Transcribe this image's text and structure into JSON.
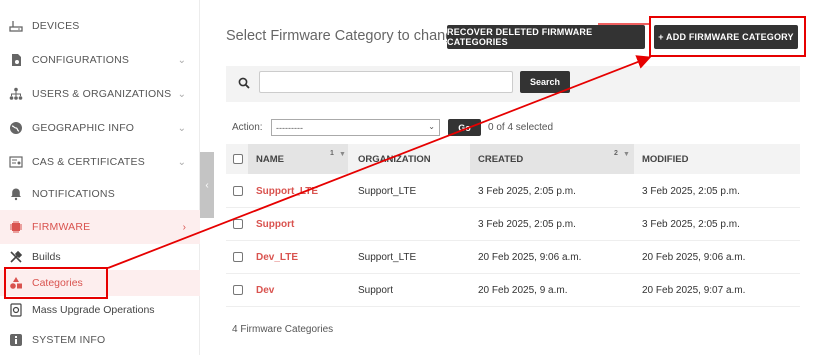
{
  "sidebar": {
    "items": [
      {
        "label": "DEVICES",
        "icon": "router-icon",
        "chevron": ""
      },
      {
        "label": "CONFIGURATIONS",
        "icon": "config-file-icon",
        "chevron": "⌄"
      },
      {
        "label": "USERS & ORGANIZATIONS",
        "icon": "org-tree-icon",
        "chevron": "⌄"
      },
      {
        "label": "GEOGRAPHIC INFO",
        "icon": "globe-icon",
        "chevron": "⌄"
      },
      {
        "label": "CAS & CERTIFICATES",
        "icon": "certificate-icon",
        "chevron": "⌄"
      },
      {
        "label": "NOTIFICATIONS",
        "icon": "bell-icon",
        "chevron": ""
      },
      {
        "label": "FIRMWARE",
        "icon": "chip-icon",
        "chevron": "›"
      }
    ],
    "sub_items": [
      {
        "label": "Builds",
        "icon": "tools-icon"
      },
      {
        "label": "Categories",
        "icon": "shapes-icon"
      },
      {
        "label": "Mass Upgrade Operations",
        "icon": "upgrade-icon"
      }
    ],
    "system_info": "SYSTEM INFO",
    "toggle": "‹"
  },
  "main": {
    "title": "Select Firmware Category to change",
    "recover_button": "RECOVER DELETED FIRMWARE CATEGORIES",
    "add_button": "+ ADD FIRMWARE CATEGORY",
    "search_button": "Search",
    "search_value": "",
    "action_label": "Action:",
    "action_selected": "---------",
    "go_button": "Go",
    "selected_text": "0 of 4 selected",
    "columns": {
      "name": "NAME",
      "name_sort": "1",
      "organization": "ORGANIZATION",
      "created": "CREATED",
      "created_sort": "2",
      "modified": "MODIFIED"
    },
    "rows": [
      {
        "name": "Support_LTE",
        "organization": "Support_LTE",
        "created": "3 Feb 2025, 2:05 p.m.",
        "modified": "3 Feb 2025, 2:05 p.m."
      },
      {
        "name": "Support",
        "organization": "",
        "created": "3 Feb 2025, 2:05 p.m.",
        "modified": "3 Feb 2025, 2:05 p.m."
      },
      {
        "name": "Dev_LTE",
        "organization": "Support_LTE",
        "created": "20 Feb 2025, 9:06 a.m.",
        "modified": "20 Feb 2025, 9:06 a.m."
      },
      {
        "name": "Dev",
        "organization": "Support",
        "created": "20 Feb 2025, 9 a.m.",
        "modified": "20 Feb 2025, 9:07 a.m."
      }
    ],
    "footer": "4 Firmware Categories"
  },
  "colors": {
    "accent": "#d9534f",
    "annotation": "#e60000",
    "dark_button": "#333333"
  }
}
